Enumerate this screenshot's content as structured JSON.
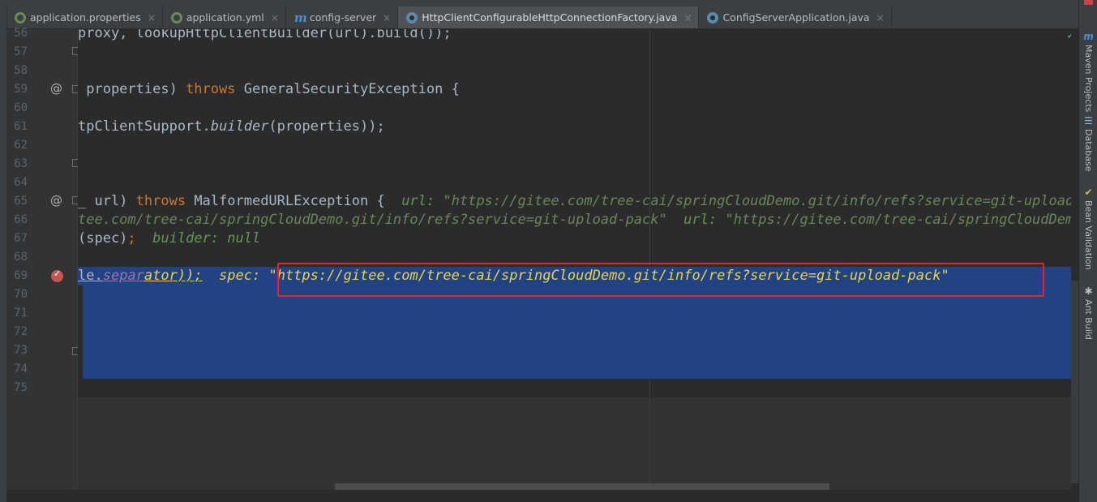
{
  "tabs": [
    {
      "label": "application.properties",
      "icon": "spring-icon",
      "active": false
    },
    {
      "label": "application.yml",
      "icon": "spring-icon",
      "active": false
    },
    {
      "label": "config-server",
      "icon": "maven-icon",
      "active": false
    },
    {
      "label": "HttpClientConfigurableHttpConnectionFactory.java",
      "icon": "class-icon",
      "active": true
    },
    {
      "label": "ConfigServerApplication.java",
      "icon": "class-icon",
      "active": false
    }
  ],
  "close_glyph": "×",
  "line_numbers": [
    "56",
    "57",
    "58",
    "59",
    "60",
    "61",
    "62",
    "63",
    "64",
    "65",
    "66",
    "67",
    "68",
    "69",
    "70",
    "71",
    "72",
    "73",
    "74",
    "75"
  ],
  "gutter_at_glyph": "@",
  "code": {
    "l56": "proxy, lookupHttpClientBuilder(url).build());",
    "l59_a": " properties) ",
    "l59_kw": "throws",
    "l59_b": " GeneralSecurityException {",
    "l61_a": "tpClientSupport.",
    "l61_it": "builder",
    "l61_b": "(properties));",
    "l65_a": "_ url) ",
    "l65_kw": "throws",
    "l65_b": " MalformedURLException {  ",
    "l65_hint_label": "url: ",
    "l65_hint_val": "\"https://gitee.com/tree-cai/springCloudDemo.git/info/refs?service=git-upload-pack\"",
    "l66_hint_a": "tee.com/tree-cai/springCloudDemo.git/info/refs?service=git-upload-pack\"",
    "l66_hint_label": "  url: ",
    "l66_hint_b": "\"https://gitee.com/tree-cai/springCloudDemo.git/info/refs?service=git-upload-pack\"",
    "l67_a": "(spec)",
    "l67_semi": ";",
    "l67_hint": "  builder: null",
    "l69_a": "le.",
    "l69_field_a": "separ",
    "l69_field_b": "ator",
    "l69_b": "));",
    "l69_label": "  spec: ",
    "l69_value": "\"https://gitee.com/tree-cai/springCloudDemo.git/info/refs?service=git-upload-pack\""
  },
  "right_tools": [
    {
      "label": "Maven Projects",
      "icon": "maven-icon"
    },
    {
      "label": "Database",
      "icon": "database-icon"
    },
    {
      "label": "Bean Validation",
      "icon": "bean-validation-icon"
    },
    {
      "label": "Ant Build",
      "icon": "ant-build-icon"
    }
  ],
  "status_check": "✓",
  "colors": {
    "editor_bg": "#2b2b2b",
    "gutter_bg": "#313335",
    "selection": "#214283",
    "keyword": "#cc7832",
    "inline_hint": "#629755",
    "highlight_box": "#ee2222",
    "breakpoint": "#c75450"
  }
}
